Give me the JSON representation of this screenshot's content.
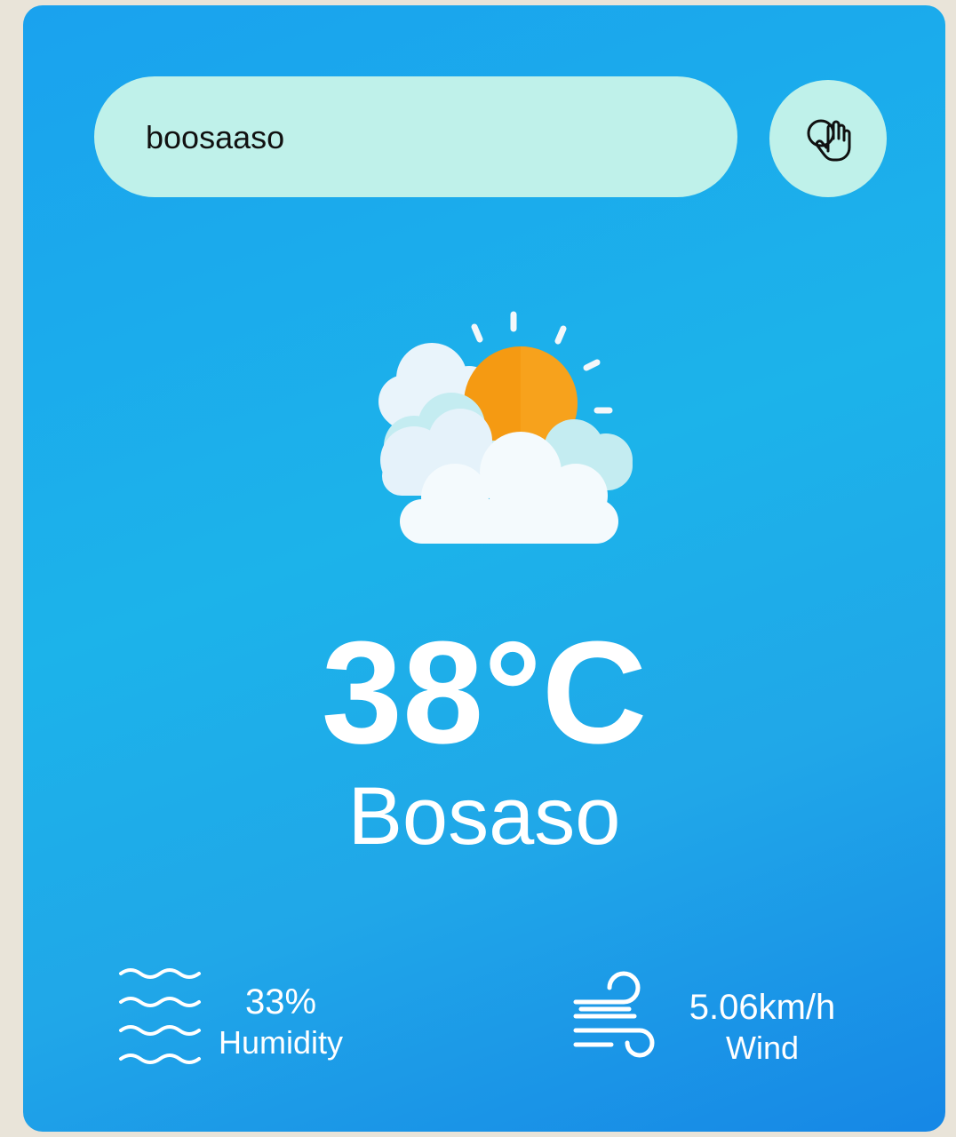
{
  "search": {
    "value": "boosaaso",
    "button_icon": "hand-pointer-icon"
  },
  "weather": {
    "icon": "partly-cloudy-sun-icon",
    "temperature": "38°C",
    "city": "Bosaso"
  },
  "details": {
    "humidity": {
      "icon": "humidity-waves-icon",
      "value": "33%",
      "label": "Humidity"
    },
    "wind": {
      "icon": "wind-icon",
      "value": "5.06km/h",
      "label": "Wind"
    }
  },
  "colors": {
    "card_background": "#1cb3ea",
    "input_background": "#bff1ea",
    "sun": "#f59a12",
    "text": "#ffffff"
  }
}
